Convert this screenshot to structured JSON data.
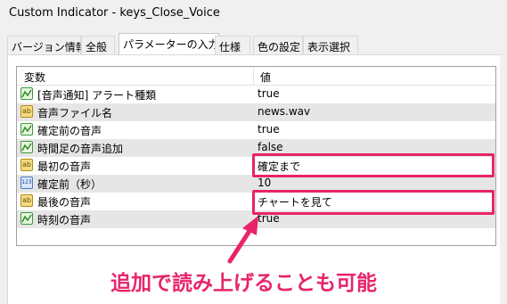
{
  "window": {
    "title": "Custom Indicator - keys_Close_Voice"
  },
  "tabs": [
    {
      "label": "バージョン情報"
    },
    {
      "label": "全般"
    },
    {
      "label": "パラメーターの入力"
    },
    {
      "label": "仕様"
    },
    {
      "label": "色の設定"
    },
    {
      "label": "表示選択"
    }
  ],
  "table": {
    "headers": {
      "variable": "変数",
      "value": "値"
    },
    "rows": [
      {
        "type": "bool",
        "name": "[音声通知] アラート種類",
        "value": "true"
      },
      {
        "type": "string",
        "name": "音声ファイル名",
        "value": "news.wav"
      },
      {
        "type": "bool",
        "name": "確定前の音声",
        "value": "true"
      },
      {
        "type": "bool",
        "name": "時間足の音声追加",
        "value": "false"
      },
      {
        "type": "string",
        "name": "最初の音声",
        "value": "確定まで"
      },
      {
        "type": "number",
        "name": "確定前（秒）",
        "value": "10"
      },
      {
        "type": "string",
        "name": "最後の音声",
        "value": "チャートを見て"
      },
      {
        "type": "bool",
        "name": "時刻の音声",
        "value": "true"
      }
    ]
  },
  "icons": {
    "string_text": "ab",
    "number_text": "123"
  },
  "annotation": {
    "caption": "追加で読み上げることも可能",
    "color": "#e8246b"
  }
}
